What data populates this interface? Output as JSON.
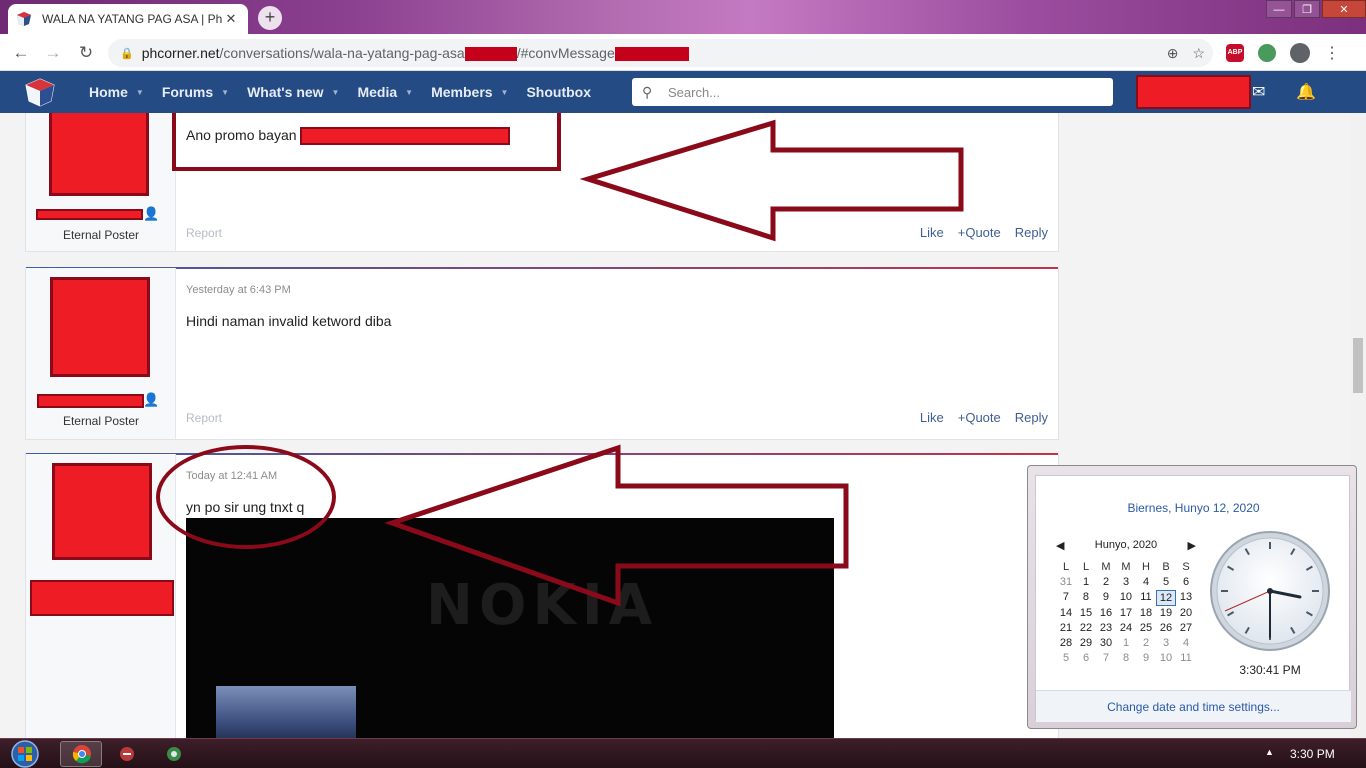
{
  "browser": {
    "tab_title": "WALA NA YATANG PAG ASA | Ph",
    "tab_close": "✕",
    "new_tab": "+",
    "url_host": "phcorner.net",
    "url_path": "/conversations/wala-na-yatang-pag-asa",
    "url_fragment": "/#convMessage",
    "window_controls": [
      "—",
      "❐",
      "✕"
    ]
  },
  "forum_nav": {
    "items": [
      {
        "label": "Home"
      },
      {
        "label": "Forums"
      },
      {
        "label": "What's new"
      },
      {
        "label": "Media"
      },
      {
        "label": "Members"
      },
      {
        "label": "Shoutbox"
      }
    ],
    "search_placeholder": "Search..."
  },
  "posts": [
    {
      "message": "Ano promo bayan",
      "user_title": "Eternal Poster",
      "report": "Report",
      "like": "Like",
      "quote": "Quote",
      "reply": "Reply"
    },
    {
      "date": "Yesterday at 6:43 PM",
      "message": "Hindi naman invalid ketword diba",
      "user_title": "Eternal Poster",
      "report": "Report",
      "like": "Like",
      "quote": "Quote",
      "reply": "Reply"
    },
    {
      "date": "Today at 12:41 AM",
      "message": "yn po sir ung tnxt q",
      "image_text": "NOKIA"
    }
  ],
  "calendar": {
    "full_date": "Biernes, Hunyo 12, 2020",
    "month_label": "Hunyo, 2020",
    "weekdays": [
      "L",
      "L",
      "M",
      "M",
      "H",
      "B",
      "S"
    ],
    "weeks": [
      [
        "31",
        "1",
        "2",
        "3",
        "4",
        "5",
        "6"
      ],
      [
        "7",
        "8",
        "9",
        "10",
        "11",
        "12",
        "13"
      ],
      [
        "14",
        "15",
        "16",
        "17",
        "18",
        "19",
        "20"
      ],
      [
        "21",
        "22",
        "23",
        "24",
        "25",
        "26",
        "27"
      ],
      [
        "28",
        "29",
        "30",
        "1",
        "2",
        "3",
        "4"
      ],
      [
        "5",
        "6",
        "7",
        "8",
        "9",
        "10",
        "11"
      ]
    ],
    "today": "12",
    "clock_time": "3:30:41 PM",
    "footer_link": "Change date and time settings..."
  },
  "taskbar": {
    "time": "3:30 PM"
  },
  "colors": {
    "forum_nav": "#254b84",
    "annotation": "#8b0a1a",
    "redaction": "#ee1c25"
  }
}
